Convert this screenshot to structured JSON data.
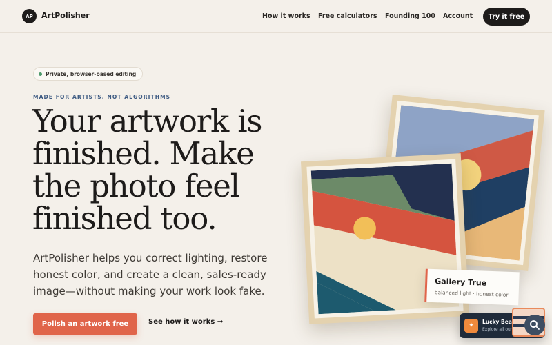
{
  "header": {
    "logo_initials": "AP",
    "brand": "ArtPolisher",
    "nav": [
      {
        "label": "How it works",
        "name": "nav-how-it-works"
      },
      {
        "label": "Free calculators",
        "name": "nav-free-calculators"
      },
      {
        "label": "Founding 100",
        "name": "nav-founding-100"
      },
      {
        "label": "Account",
        "name": "nav-account"
      }
    ],
    "cta": "Try it free"
  },
  "hero": {
    "pill": "Private, browser-based editing",
    "eyebrow": "MADE FOR ARTISTS, NOT ALGORITHMS",
    "headline": "Your artwork is finished. Make the photo feel finished too.",
    "subcopy": "ArtPolisher helps you correct lighting, restore honest color, and create a clean, sales-ready image—without making your work look fake.",
    "primary_button": "Polish an artwork free",
    "secondary_link": "See how it works →"
  },
  "artwork_card": {
    "title": "Gallery True",
    "subtitle": "balanced light · honest color"
  },
  "widget": {
    "title": "Lucky Bear Mini",
    "subtitle": "Explore all our"
  },
  "colors": {
    "background": "#f4f0ea",
    "accent": "#e0644a",
    "dark": "#1d1b1a",
    "eyebrow_blue": "#3d5a82"
  }
}
